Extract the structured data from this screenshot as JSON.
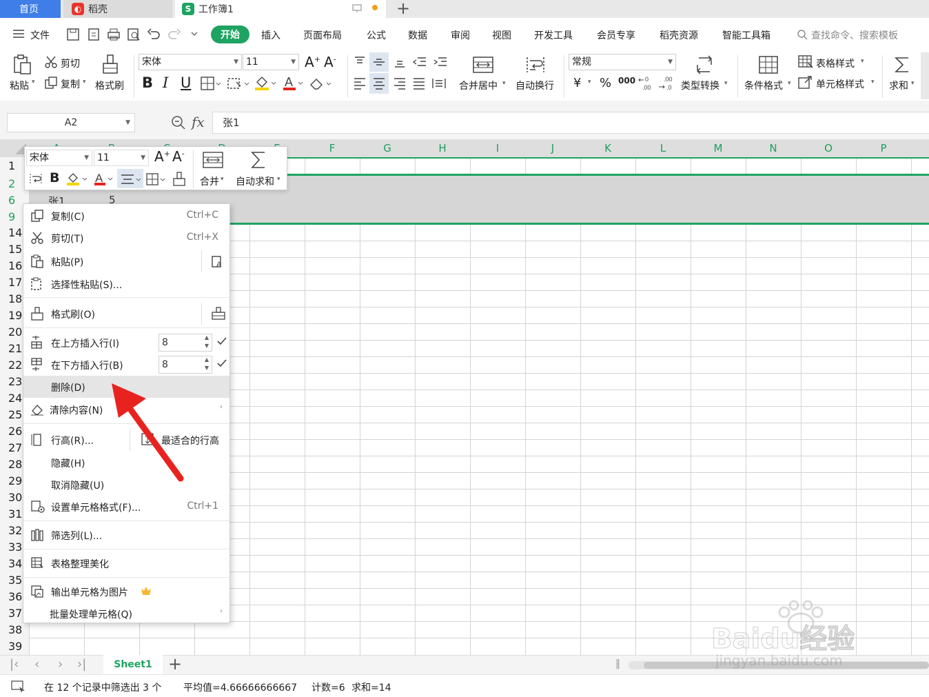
{
  "tabs": {
    "home": "首页",
    "daoke": "稻壳",
    "book": "工作簿1"
  },
  "menu": {
    "file": "文件",
    "items": [
      "开始",
      "插入",
      "页面布局",
      "公式",
      "数据",
      "审阅",
      "视图",
      "开发工具",
      "会员专享",
      "稻壳资源",
      "智能工具箱"
    ],
    "search_placeholder": "查找命令、搜索模板"
  },
  "ribbon": {
    "paste": "粘贴",
    "cut": "剪切",
    "copy": "复制",
    "format_painter": "格式刷",
    "font": "宋体",
    "size": "11",
    "merge_center": "合并居中",
    "wrap": "自动换行",
    "number_format": "常规",
    "type_convert": "类型转换",
    "cond_format": "条件格式",
    "table_style": "表格样式",
    "cell_style": "单元格样式",
    "sum": "求和",
    "currency": "¥",
    "percent": "%",
    "thousands": "000"
  },
  "formula_bar": {
    "name_box": "A2",
    "fx": "fx",
    "value": "张1"
  },
  "columns": [
    "A",
    "B",
    "C",
    "D",
    "E",
    "F",
    "G",
    "H",
    "I",
    "J",
    "K",
    "L",
    "M",
    "N",
    "O",
    "P"
  ],
  "rows": [
    "1",
    "2",
    "6",
    "9",
    "14",
    "15",
    "16",
    "17",
    "18",
    "19",
    "20",
    "21",
    "22",
    "23",
    "24",
    "25",
    "26",
    "27",
    "28",
    "29",
    "30",
    "31",
    "32",
    "33",
    "34",
    "35",
    "36",
    "37",
    "38",
    "39"
  ],
  "cells": {
    "a6": "张1",
    "b6": "5"
  },
  "mini_toolbar": {
    "font": "宋体",
    "size": "11",
    "merge": "合并",
    "autosum": "自动求和"
  },
  "context_menu": {
    "copy": "复制(C)",
    "copy_sc": "Ctrl+C",
    "cut": "剪切(T)",
    "cut_sc": "Ctrl+X",
    "paste": "粘贴(P)",
    "paste_special": "选择性粘贴(S)...",
    "format_painter": "格式刷(O)",
    "insert_above": "在上方插入行(I)",
    "insert_above_n": "8",
    "insert_below": "在下方插入行(B)",
    "insert_below_n": "8",
    "delete": "删除(D)",
    "clear": "清除内容(N)",
    "row_height": "行高(R)...",
    "best_fit": "最适合的行高",
    "hide": "隐藏(H)",
    "unhide": "取消隐藏(U)",
    "format_cells": "设置单元格格式(F)...",
    "format_cells_sc": "Ctrl+1",
    "filter_col": "筛选列(L)...",
    "beautify": "表格整理美化",
    "export_image": "输出单元格为图片",
    "batch": "批量处理单元格(Q)"
  },
  "sheets": {
    "active": "Sheet1"
  },
  "status": {
    "filter": "在 12 个记录中筛选出 3 个",
    "avg": "平均值=4.66666666667",
    "count": "计数=6",
    "sum": "求和=14"
  },
  "watermark": "Baidu经验 jingyan.baidu.com",
  "colors": {
    "accent_green": "#1ea362",
    "home_blue": "#3f7ee8",
    "arrow_red": "#e8231f"
  }
}
